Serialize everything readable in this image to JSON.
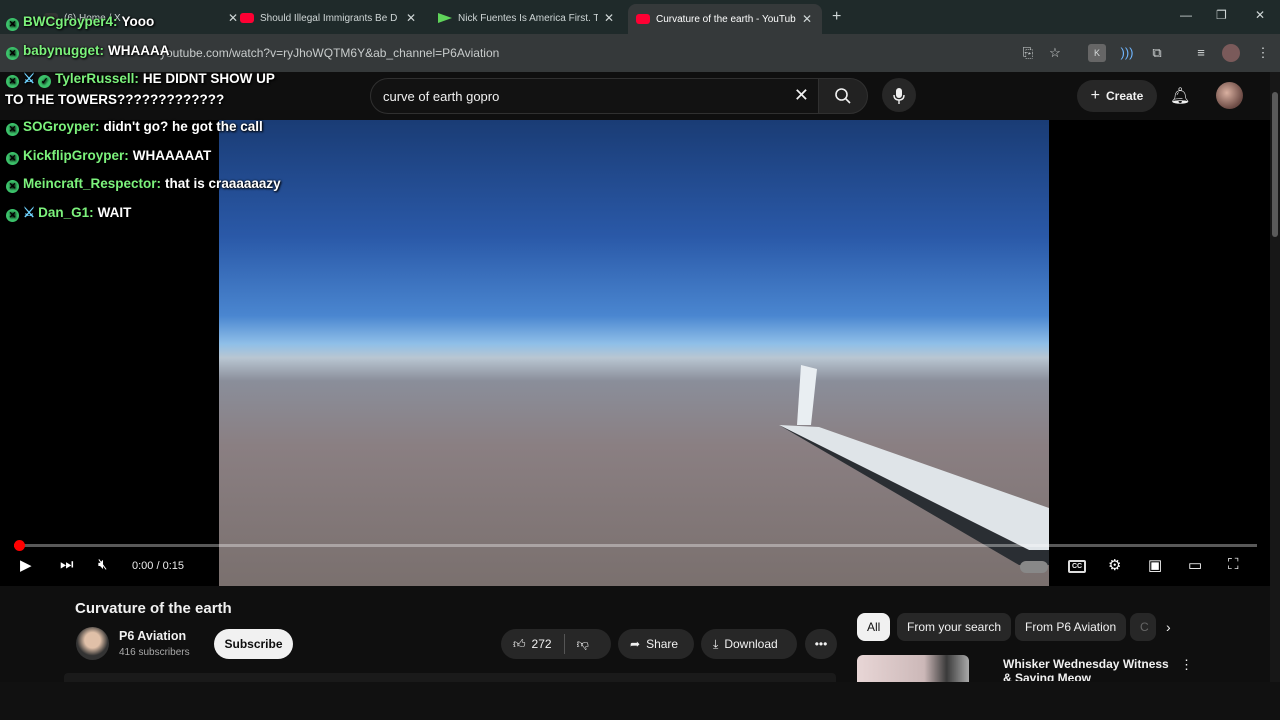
{
  "browser": {
    "tabs": [
      {
        "label": "(6) Home / X",
        "favicon_color": "#333333"
      },
      {
        "label": "Should Illegal Immigrants Be D",
        "favicon_color": "#ff0033"
      },
      {
        "label": "Nick Fuentes Is America First. T",
        "favicon_color": "#5fd35a"
      },
      {
        "label": "Curvature of the earth - YouTube",
        "favicon_color": "#ff0033"
      }
    ],
    "url": "youtube.com/watch?v=ryJhoWQTM6Y&ab_channel=P6Aviation"
  },
  "youtube": {
    "search_query": "curve of earth gopro",
    "create_label": "Create"
  },
  "chat": [
    {
      "user": "BWCgroyper4:",
      "text": "Yooo",
      "sword": false,
      "check": false
    },
    {
      "user": "babynugget:",
      "text": "WHAAAA",
      "sword": false,
      "check": false
    },
    {
      "user": "TylerRussell:",
      "text": "HE DIDNT SHOW UP",
      "sword": true,
      "check": true
    },
    {
      "user": "",
      "text": "TO THE TOWERS?????????????",
      "sword": false,
      "check": false
    },
    {
      "user": "SOGroyper:",
      "text": "didn't go? he got the call",
      "sword": false,
      "check": false
    },
    {
      "user": "KickflipGroyper:",
      "text": "WHAAAAAT",
      "sword": false,
      "check": false
    },
    {
      "user": "Meincraft_Respector:",
      "text": "that is craaaaaazy",
      "sword": false,
      "check": false
    },
    {
      "user": "Dan_G1:",
      "text": "WAIT",
      "sword": true,
      "check": false
    }
  ],
  "player": {
    "time": "0:00 / 0:15",
    "progress": 0.005
  },
  "video": {
    "title": "Curvature of the earth",
    "channel": "P6 Aviation",
    "subscribers": "416 subscribers",
    "subscribe_label": "Subscribe",
    "likes": "272",
    "share_label": "Share",
    "download_label": "Download"
  },
  "chips": [
    "All",
    "From your search",
    "From P6 Aviation",
    "C"
  ],
  "recommendation": {
    "title": "Whisker Wednesday Witness & Saving Meow"
  },
  "colors": {
    "accent_red": "#ff0000",
    "chat_username": "#7cf27c",
    "background": "#0f0f0f"
  }
}
